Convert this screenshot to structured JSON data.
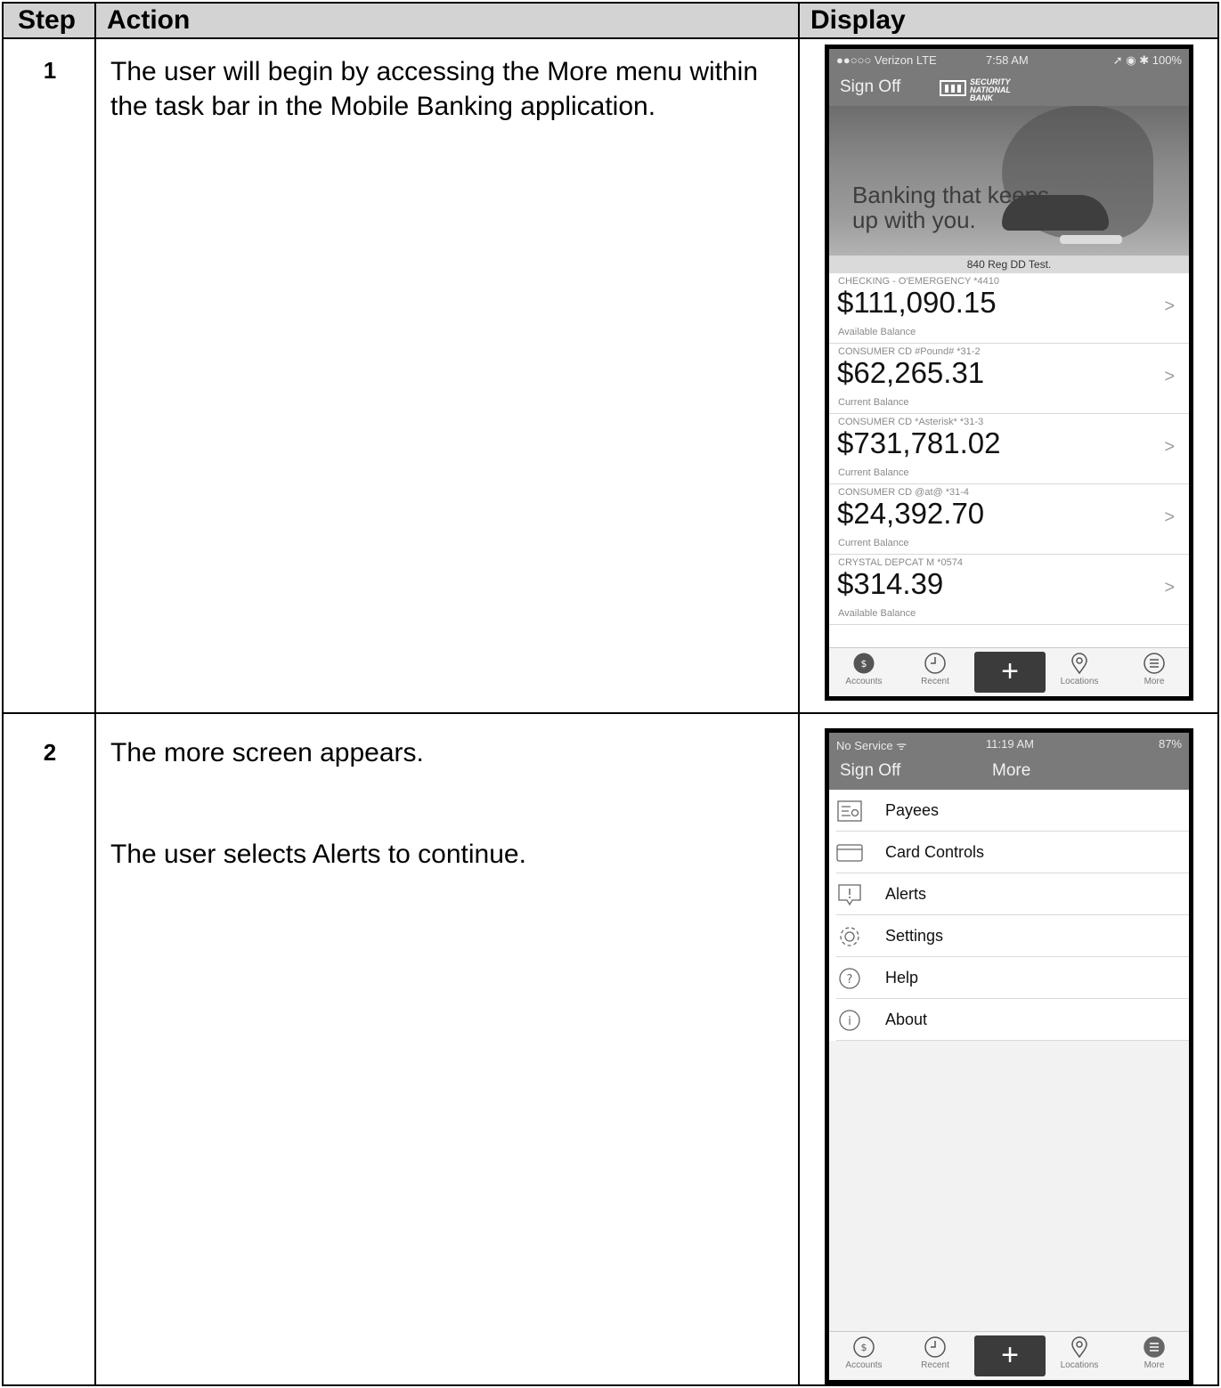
{
  "header": {
    "step": "Step",
    "action": "Action",
    "display": "Display"
  },
  "rows": [
    {
      "step": "1",
      "action": "The user will begin by accessing the More menu within the task bar in the Mobile Banking application."
    },
    {
      "step": "2",
      "action_line1": "The more screen appears.",
      "action_line2": "The user selects Alerts to continue."
    }
  ],
  "screen1": {
    "status": {
      "carrier": "●●○○○ Verizon  LTE",
      "time": "7:58 AM",
      "battery": "➚ ◉ ✱ 100%"
    },
    "nav": {
      "sign_off": "Sign Off",
      "logo_line1": "SECURITY",
      "logo_line2": "NATIONAL BANK"
    },
    "hero_line1": "Banking that keeps",
    "hero_line2": "up with you.",
    "band": "840 Reg DD Test.",
    "accounts": [
      {
        "name": "CHECKING - O'EMERGENCY *4410",
        "amount": "$111,090.15",
        "balance": "Available Balance"
      },
      {
        "name": "CONSUMER CD #Pound# *31-2",
        "amount": "$62,265.31",
        "balance": "Current Balance"
      },
      {
        "name": "CONSUMER CD *Asterisk* *31-3",
        "amount": "$731,781.02",
        "balance": "Current Balance"
      },
      {
        "name": "CONSUMER CD @at@ *31-4",
        "amount": "$24,392.70",
        "balance": "Current Balance"
      },
      {
        "name": "CRYSTAL DEPCAT M *0574",
        "amount": "$314.39",
        "balance": "Available Balance"
      }
    ],
    "chevron": ">",
    "tabs": {
      "accounts": "Accounts",
      "recent": "Recent",
      "plus": "+",
      "locations": "Locations",
      "more": "More"
    }
  },
  "screen2": {
    "status": {
      "carrier": "No Service ᯤ",
      "time": "11:19 AM",
      "battery": "87%"
    },
    "nav": {
      "sign_off": "Sign Off",
      "title": "More"
    },
    "items": [
      "Payees",
      "Card Controls",
      "Alerts",
      "Settings",
      "Help",
      "About"
    ],
    "tabs": {
      "accounts": "Accounts",
      "recent": "Recent",
      "plus": "+",
      "locations": "Locations",
      "more": "More"
    }
  }
}
